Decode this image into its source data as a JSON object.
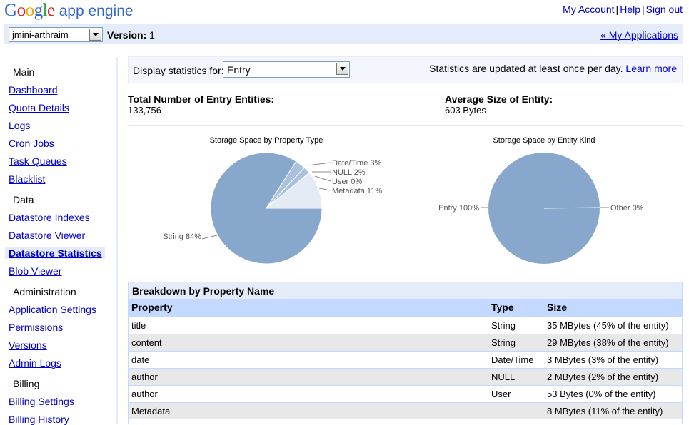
{
  "header": {
    "logo_google": "Google",
    "logo_appengine": "app engine",
    "links": [
      "My Account",
      "Help",
      "Sign out"
    ]
  },
  "appbar": {
    "app_id": "jmini-arthraim",
    "version_label": "Version:",
    "version_value": "1",
    "my_apps": "« My Applications"
  },
  "sidebar": {
    "groups": [
      {
        "label": "Main",
        "items": [
          "Dashboard",
          "Quota Details",
          "Logs",
          "Cron Jobs",
          "Task Queues",
          "Blacklist"
        ]
      },
      {
        "label": "Data",
        "items": [
          "Datastore Indexes",
          "Datastore Viewer",
          "Datastore Statistics",
          "Blob Viewer"
        ]
      },
      {
        "label": "Administration",
        "items": [
          "Application Settings",
          "Permissions",
          "Versions",
          "Admin Logs"
        ]
      },
      {
        "label": "Billing",
        "items": [
          "Billing Settings",
          "Billing History"
        ]
      }
    ],
    "active": "Datastore Statistics"
  },
  "stats": {
    "display_label": "Display statistics for:",
    "selected_kind": "Entry",
    "updated_text": "Statistics are updated at least once per day.",
    "learn_more": "Learn more",
    "total_label": "Total Number of Entry Entities:",
    "total_value": "133,756",
    "avg_label": "Average Size of Entity:",
    "avg_value": "603 Bytes"
  },
  "colors": {
    "accent_blue": "#3366cc",
    "pie_main": "#87a7cc",
    "pie_light": "#a9c1dd",
    "pie_pale": "#e4ebf5",
    "header_bg": "#e5ecf9"
  },
  "chart_data": [
    {
      "type": "pie",
      "title": "Storage Space by Property Type",
      "slices": [
        {
          "label": "String 84%",
          "value": 84
        },
        {
          "label": "Date/Time 3%",
          "value": 3
        },
        {
          "label": "NULL 2%",
          "value": 2
        },
        {
          "label": "User 0%",
          "value": 0
        },
        {
          "label": "Metadata 11%",
          "value": 11
        }
      ]
    },
    {
      "type": "pie",
      "title": "Storage Space by Entity Kind",
      "slices": [
        {
          "label": "Entry 100%",
          "value": 100
        },
        {
          "label": "Other 0%",
          "value": 0
        }
      ]
    }
  ],
  "breakdown": {
    "title": "Breakdown by Property Name",
    "headers": [
      "Property",
      "Type",
      "Size"
    ],
    "rows": [
      [
        "title",
        "String",
        "35 MBytes (45% of the entity)"
      ],
      [
        "content",
        "String",
        "29 MBytes (38% of the entity)"
      ],
      [
        "date",
        "Date/Time",
        "3 MBytes (3% of the entity)"
      ],
      [
        "author",
        "NULL",
        "2 MBytes (2% of the entity)"
      ],
      [
        "author",
        "User",
        "53 Bytes (0% of the entity)"
      ],
      [
        "Metadata",
        "",
        "8 MBytes (11% of the entity)"
      ]
    ]
  }
}
